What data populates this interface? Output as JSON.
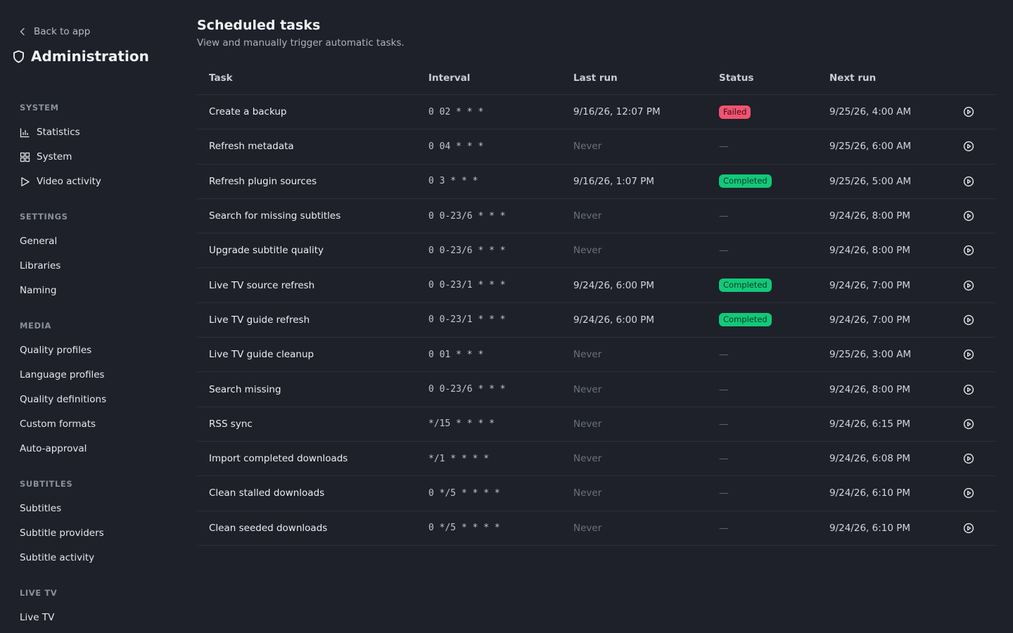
{
  "sidebar": {
    "back_label": "Back to app",
    "title": "Administration",
    "sections": [
      {
        "label": "SYSTEM",
        "items": [
          "Statistics",
          "System",
          "Video activity"
        ]
      },
      {
        "label": "SETTINGS",
        "items": [
          "General",
          "Libraries",
          "Naming"
        ]
      },
      {
        "label": "MEDIA",
        "items": [
          "Quality profiles",
          "Language profiles",
          "Quality definitions",
          "Custom formats",
          "Auto-approval"
        ]
      },
      {
        "label": "SUBTITLES",
        "items": [
          "Subtitles",
          "Subtitle providers",
          "Subtitle activity"
        ]
      },
      {
        "label": "LIVE TV",
        "items": [
          "Live TV"
        ]
      }
    ],
    "icons": {
      "Statistics": "bar-chart-icon",
      "System": "grid-icon",
      "Video activity": "play-icon"
    }
  },
  "main": {
    "title": "Scheduled tasks",
    "subtitle": "View and manually trigger automatic tasks.",
    "columns": {
      "task": "Task",
      "interval": "Interval",
      "last_run": "Last run",
      "status": "Status",
      "next_run": "Next run"
    },
    "rows": [
      {
        "task": "Create a backup",
        "interval": "0 02 * * *",
        "last_run": "9/16/26, 12:07 PM",
        "status": "Failed",
        "next_run": "9/25/26, 4:00 AM"
      },
      {
        "task": "Refresh metadata",
        "interval": "0 04 * * *",
        "last_run": "Never",
        "status": "—",
        "next_run": "9/25/26, 6:00 AM"
      },
      {
        "task": "Refresh plugin sources",
        "interval": "0 3 * * *",
        "last_run": "9/16/26, 1:07 PM",
        "status": "Completed",
        "next_run": "9/25/26, 5:00 AM"
      },
      {
        "task": "Search for missing subtitles",
        "interval": "0 0-23/6 * * *",
        "last_run": "Never",
        "status": "—",
        "next_run": "9/24/26, 8:00 PM"
      },
      {
        "task": "Upgrade subtitle quality",
        "interval": "0 0-23/6 * * *",
        "last_run": "Never",
        "status": "—",
        "next_run": "9/24/26, 8:00 PM"
      },
      {
        "task": "Live TV source refresh",
        "interval": "0 0-23/1 * * *",
        "last_run": "9/24/26, 6:00 PM",
        "status": "Completed",
        "next_run": "9/24/26, 7:00 PM"
      },
      {
        "task": "Live TV guide refresh",
        "interval": "0 0-23/1 * * *",
        "last_run": "9/24/26, 6:00 PM",
        "status": "Completed",
        "next_run": "9/24/26, 7:00 PM"
      },
      {
        "task": "Live TV guide cleanup",
        "interval": "0 01 * * *",
        "last_run": "Never",
        "status": "—",
        "next_run": "9/25/26, 3:00 AM"
      },
      {
        "task": "Search missing",
        "interval": "0 0-23/6 * * *",
        "last_run": "Never",
        "status": "—",
        "next_run": "9/24/26, 8:00 PM"
      },
      {
        "task": "RSS sync",
        "interval": "*/15 * * * *",
        "last_run": "Never",
        "status": "—",
        "next_run": "9/24/26, 6:15 PM"
      },
      {
        "task": "Import completed downloads",
        "interval": "*/1 * * * *",
        "last_run": "Never",
        "status": "—",
        "next_run": "9/24/26, 6:08 PM"
      },
      {
        "task": "Clean stalled downloads",
        "interval": "0 */5 * * * *",
        "last_run": "Never",
        "status": "—",
        "next_run": "9/24/26, 6:10 PM"
      },
      {
        "task": "Clean seeded downloads",
        "interval": "0 */5 * * * *",
        "last_run": "Never",
        "status": "—",
        "next_run": "9/24/26, 6:10 PM"
      }
    ]
  },
  "colors": {
    "background": "#1e2129",
    "failed": "#f0546f",
    "completed": "#12c97a"
  }
}
